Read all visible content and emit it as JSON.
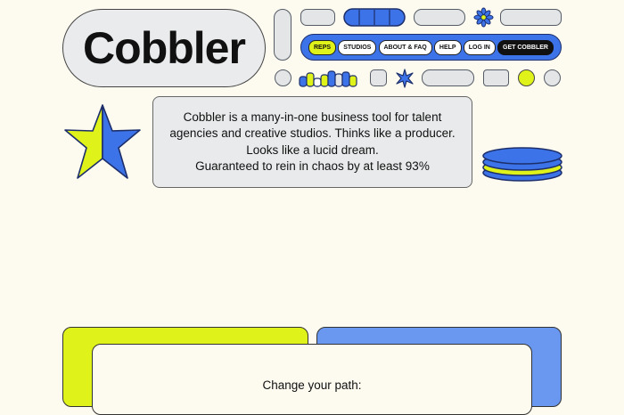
{
  "brand": {
    "name": "Cobbler"
  },
  "nav": {
    "items": [
      {
        "label": "REPS",
        "active": true
      },
      {
        "label": "STUDIOS"
      },
      {
        "label": "ABOUT & FAQ"
      },
      {
        "label": "HELP"
      },
      {
        "label": "LOG IN"
      }
    ],
    "cta": "GET COBBLER"
  },
  "hero": {
    "lines": [
      "Cobbler is a many-in-one business tool for talent",
      "agencies and creative studios. Thinks like a producer.",
      "Looks like a lucid dream.",
      "Guaranteed to rein in chaos by at least 93%"
    ]
  },
  "path": {
    "title": "Change your path:"
  },
  "colors": {
    "background": "#fdfaef",
    "accent_yellow": "#dff31a",
    "accent_blue": "#3c73e8",
    "grey": "#e3e5e6"
  },
  "icons": [
    "asterisk-flower-icon",
    "star-burst-icon",
    "sparkle-icon",
    "disk-stack-icon",
    "bar-graph-icon"
  ]
}
